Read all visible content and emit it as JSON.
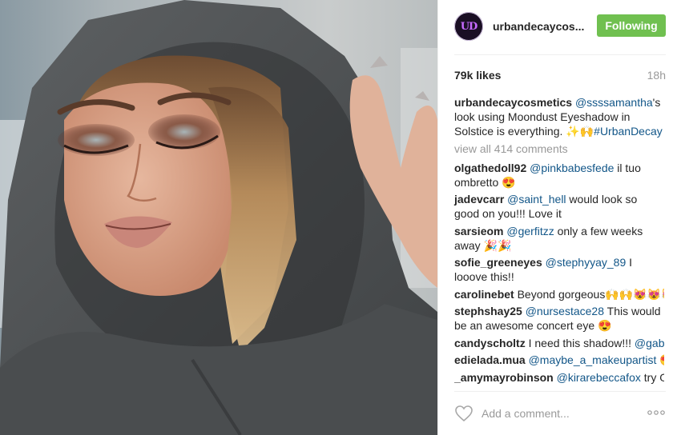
{
  "post": {
    "username": "urbandecaycos...",
    "avatar_text": "UD",
    "follow_label": "Following",
    "likes": "79k likes",
    "time": "18h",
    "caption": {
      "user": "urbandecaycosmetics",
      "mention": "@ssssamantha",
      "text1": "'s look using Moondust Eyeshadow in Solstice is everything. ✨🙌",
      "hashtag": "#UrbanDecay"
    },
    "view_all": "view all 414 comments",
    "comments": [
      {
        "user": "olgathedoll92",
        "mention": "@pinkbabesfede",
        "text": " il tuo ombretto 😍"
      },
      {
        "user": "jadevcarr",
        "mention": "@saint_hell",
        "text": " would look so good on you!!! Love it"
      },
      {
        "user": "sarsieom",
        "mention": "@gerfitzz",
        "text": " only a few weeks away 🎉🎉"
      },
      {
        "user": "sofie_greeneyes",
        "mention": "@stephyyay_89",
        "text": " I looove this!!"
      },
      {
        "user": "carolinebet",
        "mention": "",
        "text": " Beyond gorgeous🙌🙌😻😻😻"
      },
      {
        "user": "stephshay25",
        "mention": "@nursestace28",
        "text": " This would be an awesome concert eye 😍"
      },
      {
        "user": "candyscholtz",
        "mention": "",
        "text": " I need this shadow!!! ",
        "mention2": "@gabi_h"
      },
      {
        "user": "edielada.mua",
        "mention": "@maybe_a_makeupartist",
        "text": " 😍"
      },
      {
        "user": "_amymayrobinson",
        "mention": "@kirarebeccafox",
        "text": " try OIL"
      }
    ],
    "add_comment_placeholder": "Add a comment...",
    "more_icon": "ellipsis-icon",
    "like_icon": "heart-icon"
  },
  "colors": {
    "follow_green": "#70c050",
    "link_blue": "#125688",
    "muted": "#999999"
  }
}
